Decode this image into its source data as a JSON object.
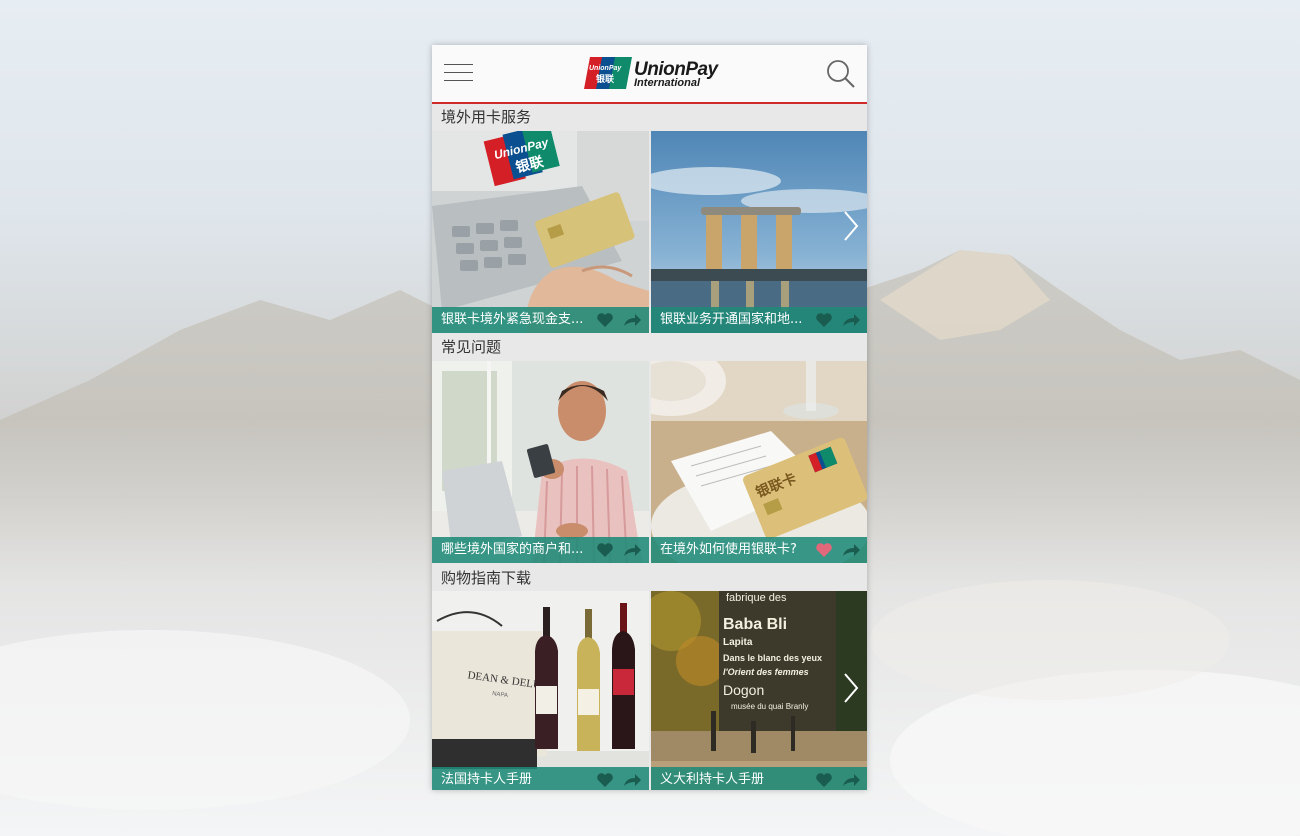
{
  "app": {
    "brand": "UnionPay",
    "brand_sub": "International",
    "logo_cn": "银联",
    "logo_small": "UnionPay"
  },
  "colors": {
    "accent_red": "#cf2b2b",
    "caption_teal": "#1e8a78",
    "heart_dark": "#1b5c50",
    "heart_active": "#e0687a"
  },
  "icons": {
    "menu": "hamburger-icon",
    "search": "search-icon",
    "favorite": "heart-icon",
    "share": "share-arrow-icon",
    "next": "chevron-right-icon"
  },
  "sections": [
    {
      "title": "境外用卡服务",
      "tiles": [
        {
          "caption": "银联卡境外紧急现金支...",
          "favorited": false,
          "scene": "atm"
        },
        {
          "caption": "银联业务开通国家和地...",
          "favorited": false,
          "scene": "marina-bay"
        }
      ]
    },
    {
      "title": "常见问题",
      "tiles": [
        {
          "caption": "哪些境外国家的商户和...",
          "favorited": false,
          "scene": "laptop-man"
        },
        {
          "caption": "在境外如何使用银联卡?",
          "favorited": true,
          "scene": "card-on-receipt"
        }
      ]
    },
    {
      "title": "购物指南下载",
      "tiles": [
        {
          "caption": "法国持卡人手册",
          "favorited": false,
          "scene": "wine-bottles"
        },
        {
          "caption": "义大利持卡人手册",
          "favorited": false,
          "scene": "paris-street"
        }
      ]
    }
  ],
  "artwork_text": {
    "atm_card_brand": "UnionPay",
    "atm_card_cn": "银联",
    "card_cn": "银联卡",
    "bag_brand": "DEAN & DELUCA",
    "bag_sub": "NAPA",
    "poster_line1": "fabrique des",
    "poster_line2": "Baba Bli",
    "poster_line3": "Lapita",
    "poster_line4": "Dans le blanc des yeux",
    "poster_line5": "l'Orient des femmes",
    "poster_line6": "Dogon",
    "poster_line7": "musée du quai Branly"
  }
}
